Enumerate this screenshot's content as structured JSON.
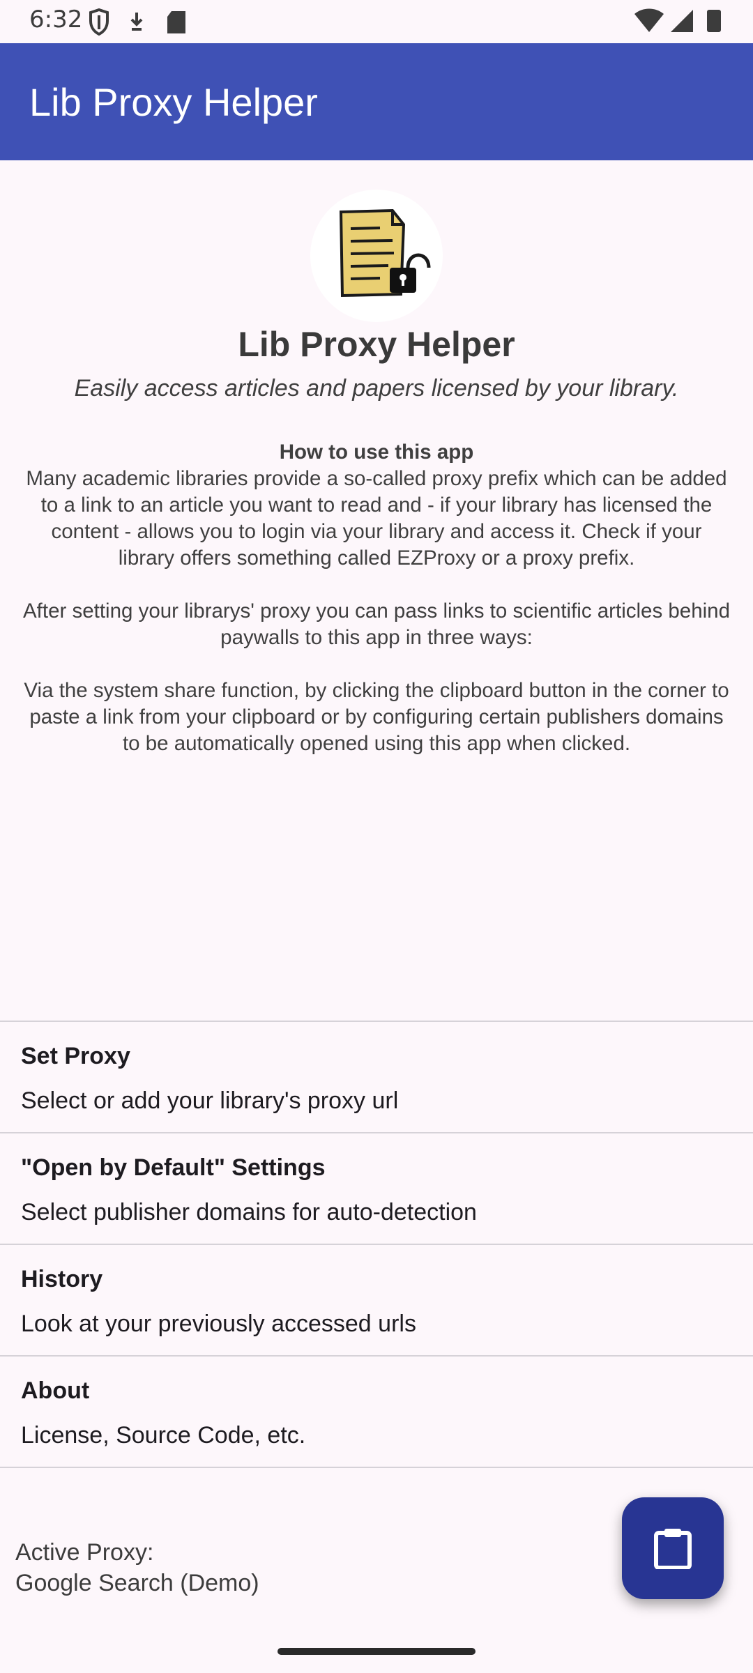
{
  "status_bar": {
    "time": "6:32",
    "left_icons": [
      "shield-icon",
      "download-icon",
      "sd-card-icon"
    ],
    "right_icons": [
      "wifi-icon",
      "signal-icon",
      "battery-icon"
    ]
  },
  "app_bar": {
    "title": "Lib Proxy Helper",
    "color": "#3f51b5"
  },
  "hero": {
    "logo": "document-lock-icon",
    "title": "Lib Proxy Helper",
    "subtitle": "Easily access articles and papers licensed by your library."
  },
  "howto": {
    "heading": "How to use this app",
    "paragraph1": "Many academic libraries provide a so-called proxy prefix which can be added to a link to an article you want to read and - if your library has licensed the content - allows you to login via your library and access it. Check if your library offers something called EZProxy or a proxy prefix.",
    "paragraph2": "After setting your librarys' proxy you can pass links to scientific articles behind paywalls to this app in three ways:",
    "paragraph3": "Via the system share function, by clicking the clipboard button in the corner to paste a link from your clipboard or by configuring certain publishers domains to be automatically opened using this app when clicked."
  },
  "menu": {
    "items": [
      {
        "title": "Set Proxy",
        "subtitle": "Select or add your library's proxy url"
      },
      {
        "title": "\"Open by Default\" Settings",
        "subtitle": "Select publisher domains for auto-detection"
      },
      {
        "title": "History",
        "subtitle": "Look at your previously accessed urls"
      },
      {
        "title": "About",
        "subtitle": "License, Source Code, etc."
      }
    ]
  },
  "active_proxy": {
    "label": "Active Proxy:",
    "value": "Google Search (Demo)"
  },
  "fab": {
    "icon": "clipboard-icon",
    "color": "#283593"
  }
}
